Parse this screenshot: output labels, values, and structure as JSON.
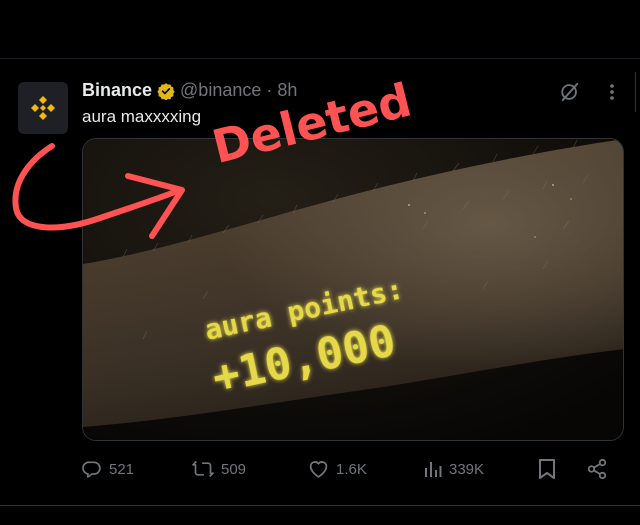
{
  "tweet": {
    "author": {
      "display_name": "Binance",
      "handle": "@binance",
      "separator": "·",
      "time": "8h",
      "verified": true,
      "avatar_icon": "binance-logo",
      "brand_color": "#f0b90b"
    },
    "text": "aura maxxxxing",
    "media": {
      "overlay_line1": "aura points:",
      "overlay_line2": "+10,000",
      "overlay_color": "#e6d94a"
    },
    "annotation": {
      "label": "Deleted",
      "color": "#ff5252"
    },
    "header_icons": [
      "grok-icon",
      "more-icon"
    ],
    "actions": {
      "replies": "521",
      "reposts": "509",
      "likes": "1.6K",
      "views": "339K",
      "icons": [
        "reply-icon",
        "repost-icon",
        "like-icon",
        "views-icon",
        "bookmark-icon",
        "share-icon"
      ]
    }
  },
  "theme": {
    "background": "#000000",
    "text_primary": "#e7e9ea",
    "text_secondary": "#71767b",
    "verified_color": "#e2b719"
  }
}
